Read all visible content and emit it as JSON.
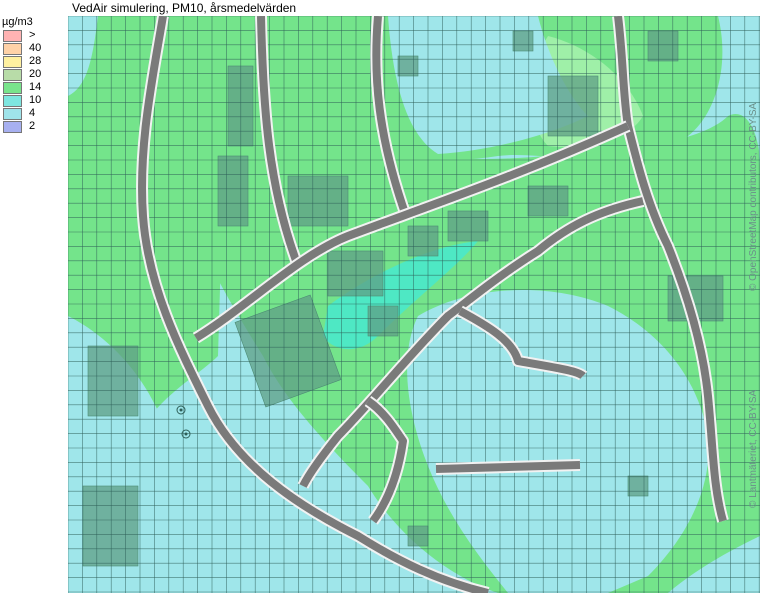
{
  "title": "VedAir simulering, PM10, årsmedelvärden",
  "legend": {
    "unit": "µg/m3",
    "classes": [
      {
        "label": ">",
        "color": "#ffb3b3"
      },
      {
        "label": "40",
        "color": "#ffd2a8"
      },
      {
        "label": "28",
        "color": "#fff0a0"
      },
      {
        "label": "20",
        "color": "#b8dca8"
      },
      {
        "label": "14",
        "color": "#79e48c"
      },
      {
        "label": "10",
        "color": "#7ee6e0"
      },
      {
        "label": "4",
        "color": "#9fe3ea"
      },
      {
        "label": "2",
        "color": "#a7b0f0"
      }
    ]
  },
  "credits": {
    "osm": "© OpenStreetMap contributors, CC-BY-SA",
    "lantmateriet": "© Lantmäteriet, CC-BY-SA"
  },
  "colors": {
    "green_zone": "#74e48b",
    "light_green": "#9ff0a8",
    "cyan_zone": "#9fe6ea",
    "teal_zone": "#4ee8c4",
    "road_fill": "#7a7a7a",
    "road_edge": "#f2f2f2",
    "building": "#5f9f86",
    "grid": "#2d5e58"
  }
}
